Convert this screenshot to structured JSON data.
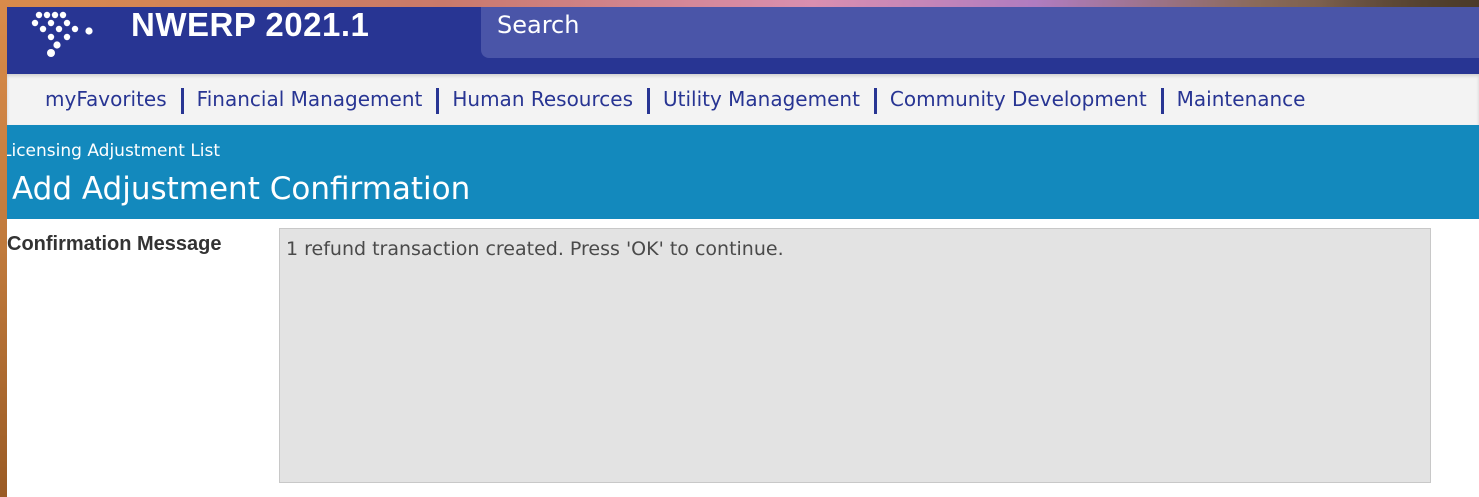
{
  "app": {
    "title": "NWERP 2021.1",
    "logo_icon": "nwerp-dots-logo-icon"
  },
  "search": {
    "label": "Search"
  },
  "nav": {
    "items": [
      {
        "label": "myFavorites"
      },
      {
        "label": "Financial Management"
      },
      {
        "label": "Human Resources"
      },
      {
        "label": "Utility Management"
      },
      {
        "label": "Community Development"
      },
      {
        "label": "Maintenance"
      }
    ]
  },
  "header": {
    "breadcrumb": "Licensing Adjustment List",
    "title": "Add Adjustment Confirmation"
  },
  "form": {
    "confirmation_label": "Confirmation Message",
    "confirmation_message": "1 refund transaction created. Press 'OK' to continue."
  },
  "colors": {
    "topbar": "#283593",
    "search_box": "#4a55a8",
    "header_band": "#1389bd",
    "nav_text": "#283593",
    "message_box": "#e3e3e3"
  }
}
